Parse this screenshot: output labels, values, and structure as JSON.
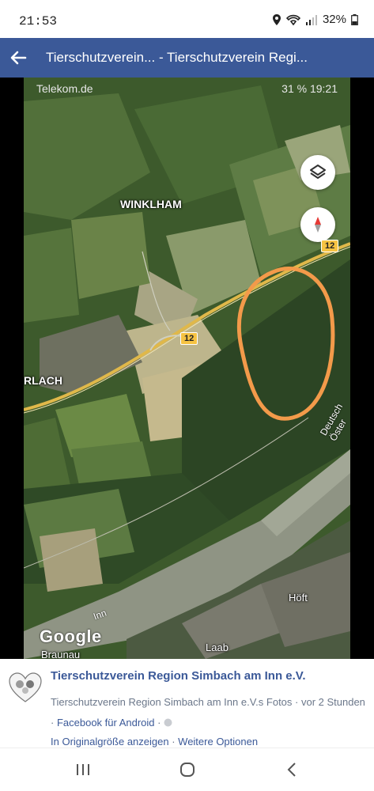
{
  "status_bar": {
    "time": "21:53",
    "battery": "32%"
  },
  "app_bar": {
    "title": "Tierschutzverein... - Tierschutzverein Regi..."
  },
  "photo": {
    "inner_status": {
      "carrier": "Telekom.de",
      "right": "31 %  19:21"
    },
    "labels": {
      "winklham": "WINKLHAM",
      "erlach": "RLACH",
      "hoeft": "Höft",
      "laab": "Laab",
      "braunau": "Braunau",
      "inn": "Inn",
      "deutsch": "Deutsch Öster",
      "road12a": "12",
      "road12b": "12"
    },
    "google_logo": "Google",
    "controls": {
      "layers": "layers-icon",
      "compass": "compass-icon"
    },
    "highlight_color": "#f39a4a"
  },
  "caption": {
    "page_name": "Tierschutzverein Region Simbach am Inn e.V.",
    "source": "Tierschutzverein Region Simbach am Inn e.V.s Fotos",
    "time": " · vor 2 Stunden · ",
    "app": "Facebook für Android",
    "privacy_sep": " · ",
    "view_full": "In Originalgröße anzeigen",
    "sep": " · ",
    "more_options": "Weitere Optionen"
  },
  "colors": {
    "facebook_blue": "#3b5998",
    "meta_gray": "#6b778a"
  }
}
